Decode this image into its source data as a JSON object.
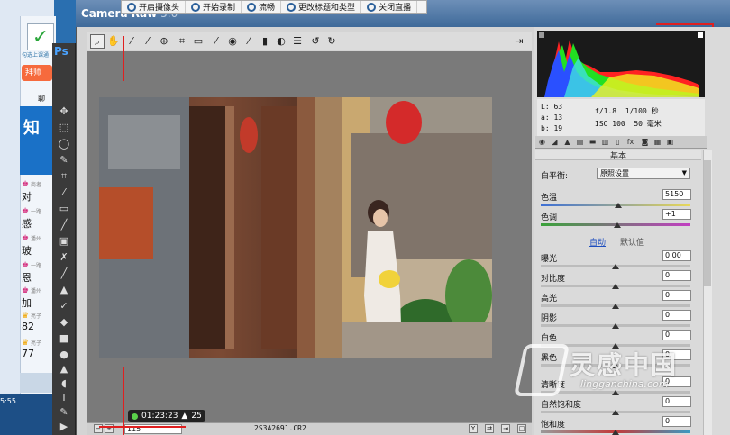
{
  "recorder": {
    "items": [
      {
        "label": "开启摄像头",
        "icon": "camera-icon"
      },
      {
        "label": "开始录制",
        "icon": "record-icon"
      },
      {
        "label": "流畅",
        "icon": "quality-icon"
      },
      {
        "label": "更改标题和类型",
        "icon": "edit-icon"
      },
      {
        "label": "关闭直播",
        "icon": "power-icon"
      }
    ],
    "timer": "01:23:23",
    "viewers": "25"
  },
  "window": {
    "title": "Camera Raw",
    "subtitle": "5.0"
  },
  "chat": {
    "logo_text": "勾选上课通",
    "button": "拜师",
    "section": "聊",
    "banner": "知",
    "entries": [
      {
        "text": "对",
        "meta": "商者"
      },
      {
        "text": "感",
        "meta": "一路"
      },
      {
        "text": "玻",
        "meta": "潘州"
      },
      {
        "text": "恩",
        "meta": "一路"
      },
      {
        "text": "加",
        "meta": "潘州"
      },
      {
        "text": "82",
        "meta": "亮子"
      },
      {
        "text": "77",
        "meta": "亮子"
      }
    ],
    "clock": "5:55"
  },
  "ps": {
    "logo": "Ps"
  },
  "preview": {
    "zoom": "115",
    "filename": "2S3A2691.CR2"
  },
  "readout": {
    "r": "63",
    "g": "13",
    "b": "19",
    "r_label": "L:",
    "g_label": "a:",
    "b_label": "b:",
    "aperture": "f/1.8",
    "shutter": "1/100 秒",
    "iso": "ISO 100",
    "focal": "50 毫米"
  },
  "panel": {
    "title": "基本",
    "wb_label": "白平衡:",
    "wb_value": "原照设置",
    "auto": "自动",
    "default": "默认值",
    "sliders": [
      {
        "label": "色温",
        "value": "5150",
        "pos": 0.52
      },
      {
        "label": "色调",
        "value": "+1",
        "pos": 0.51
      },
      {
        "label": "曝光",
        "value": "0.00",
        "pos": 0.5
      },
      {
        "label": "对比度",
        "value": "0",
        "pos": 0.5
      },
      {
        "label": "高光",
        "value": "0",
        "pos": 0.5
      },
      {
        "label": "阴影",
        "value": "0",
        "pos": 0.5
      },
      {
        "label": "白色",
        "value": "0",
        "pos": 0.5
      },
      {
        "label": "黑色",
        "value": "0",
        "pos": 0.5
      },
      {
        "label": "清晰度",
        "value": "0",
        "pos": 0.5
      },
      {
        "label": "自然饱和度",
        "value": "0",
        "pos": 0.5
      },
      {
        "label": "饱和度",
        "value": "0",
        "pos": 0.5
      }
    ]
  },
  "watermark": {
    "text": "灵感中国",
    "url": "lingganchina.com"
  },
  "colors": {
    "accent": "#1f4fbf",
    "title_bar": "#3f6a9a",
    "marker": "#e02020"
  }
}
